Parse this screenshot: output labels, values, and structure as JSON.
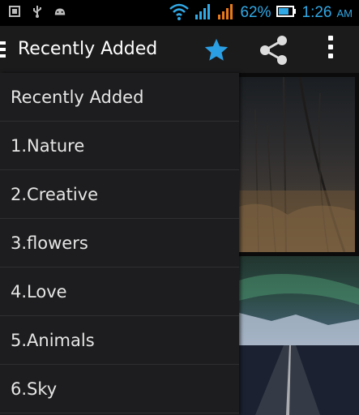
{
  "statusbar": {
    "battery_percent": "62%",
    "time": "1:26",
    "ampm": "AM",
    "accent_color": "#31a9e6",
    "left_icons": [
      "screenshot-icon",
      "usb-icon",
      "android-icon"
    ],
    "right_icons": [
      "wifi-icon",
      "signal-icon",
      "signal-icon",
      "battery-icon"
    ]
  },
  "actionbar": {
    "title": "Recently Added",
    "icons": [
      "drawer-menu-icon",
      "star-icon",
      "share-icon",
      "overflow-menu-icon"
    ],
    "star_color": "#2b9fe3"
  },
  "drawer": {
    "items": [
      {
        "label": "Recently Added"
      },
      {
        "label": "1.Nature"
      },
      {
        "label": "2.Creative"
      },
      {
        "label": "3.flowers"
      },
      {
        "label": "4.Love"
      },
      {
        "label": "5.Animals"
      },
      {
        "label": "6.Sky"
      }
    ]
  }
}
